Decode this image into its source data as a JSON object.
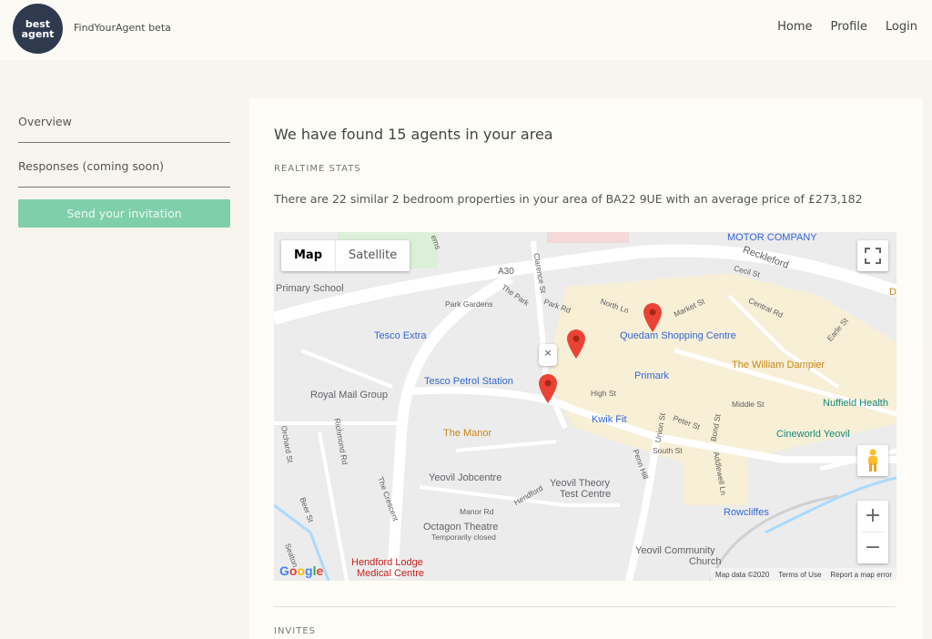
{
  "header": {
    "logo_line1": "best",
    "logo_line2": "agent",
    "brand": "FindYourAgent beta",
    "nav": [
      "Home",
      "Profile",
      "Login"
    ]
  },
  "sidebar": {
    "overview": "Overview",
    "responses": "Responses (coming soon)",
    "invite_button": "Send your invitation"
  },
  "main": {
    "headline": "We have found 15 agents in your area",
    "realtime_label": "REALTIME STATS",
    "stats_text": "There are 22 similar 2 bedroom properties in your area of BA22 9UE with an average price of £273,182",
    "invites_label": "INVITES"
  },
  "map": {
    "type_map": "Map",
    "type_satellite": "Satellite",
    "markers": 3,
    "pois": {
      "motor": "MOTOR COMPANY",
      "primary_school": "Primary School",
      "tesco_extra": "Tesco Extra",
      "royal_mail": "Royal Mail Group",
      "tesco_petrol": "Tesco Petrol Station",
      "quedam": "Quedam Shopping Centre",
      "primark": "Primark",
      "dampier": "The William Dampier",
      "nuffield": "Nuffield Health",
      "kwik_fit": "Kwik Fit",
      "manor": "The Manor",
      "cineworld": "Cineworld Yeovil",
      "jobcentre": "Yeovil Jobcentre",
      "theory": "Yeovil Theory",
      "theory2": "Test Centre",
      "octagon": "Octagon Theatre",
      "octagon_sub": "Temporarily closed",
      "rowcliffes": "Rowcliffes",
      "hendford": "Hendford Lodge",
      "hendford2": "Medical Centre",
      "community": "Yeovil Community",
      "community2": "Church",
      "d": "D"
    },
    "streets": {
      "reckleford": "Reckleford",
      "a30": "A30",
      "cecil": "Cecil St",
      "park_gardens": "Park Gardens",
      "the_park": "The Park",
      "park_rd": "Park Rd",
      "north_ln": "North Ln",
      "market_st": "Market St",
      "central_rd": "Central Rd",
      "earle_st": "Earle St",
      "high_st": "High St",
      "middle_st": "Middle St",
      "peter_st": "Peter St",
      "south_st": "South St",
      "union_st": "Union St",
      "bond_st": "Bond St",
      "addlewell": "Addlewell Ln",
      "penn_hill": "Penn Hill",
      "hendford_st": "Hendford",
      "manor_rd": "Manor Rd",
      "the_crescent": "The Crescent",
      "richmond": "Richmond Rd",
      "orchard": "Orchard St",
      "beer": "Beer St",
      "seaton": "Seaton",
      "clarence": "Clarence St",
      "ems": "ems"
    },
    "attribution": [
      "Map data ©2020",
      "Terms of Use",
      "Report a map error"
    ],
    "google": [
      "G",
      "o",
      "o",
      "g",
      "l",
      "e"
    ],
    "close_glyph": "×",
    "zoom_in": "+",
    "zoom_out": "−"
  },
  "colors": {
    "accent_button": "#7fcfab",
    "logo_bg": "#2f3a4f",
    "marker": "#ea4335"
  }
}
